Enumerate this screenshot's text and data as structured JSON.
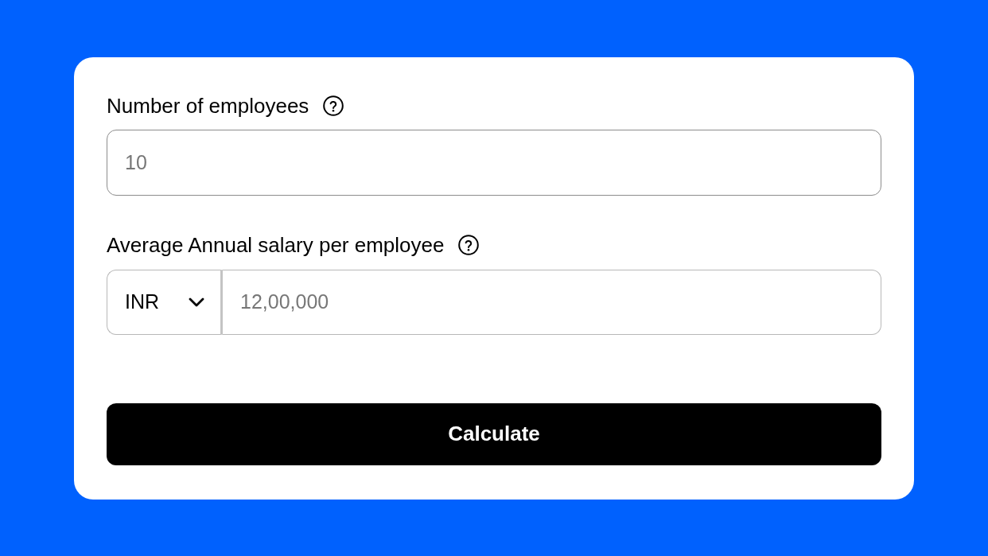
{
  "fields": [
    {
      "kind": "number",
      "label": "Number of employees",
      "placeholder": "10"
    },
    {
      "kind": "currency",
      "label": "Average Annual salary per employee",
      "currency": "INR",
      "placeholder": "12,00,000"
    }
  ],
  "button": {
    "label": "Calculate"
  }
}
